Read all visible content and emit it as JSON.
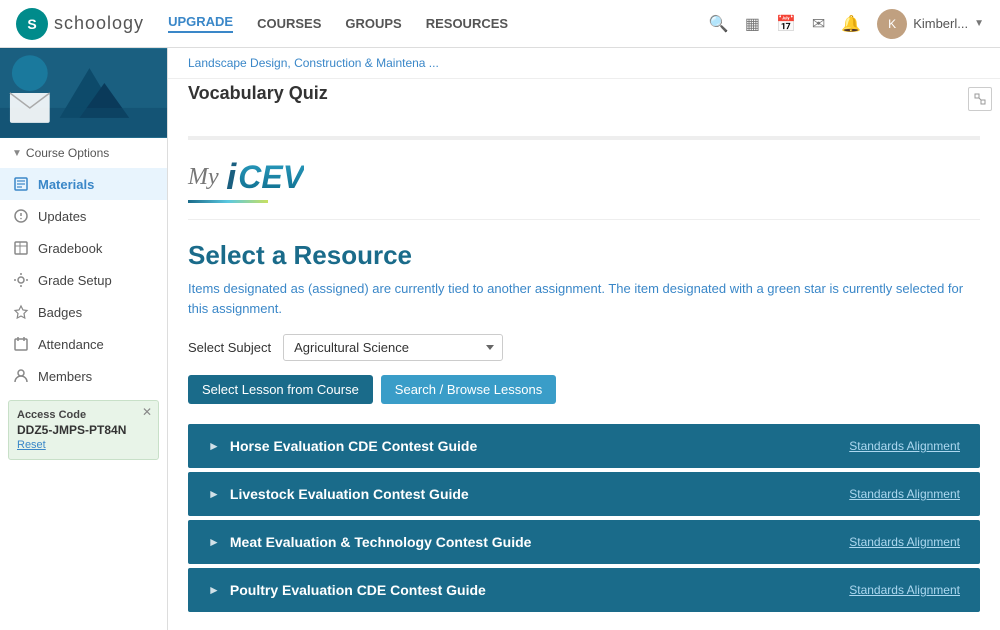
{
  "nav": {
    "logo_letter": "S",
    "logo_text": "schoology",
    "links": [
      {
        "label": "UPGRADE",
        "active": true
      },
      {
        "label": "COURSES"
      },
      {
        "label": "GROUPS"
      },
      {
        "label": "RESOURCES"
      }
    ],
    "username": "Kimberl...",
    "chevron": "▼"
  },
  "sidebar": {
    "course_options_label": "Course Options",
    "items": [
      {
        "label": "Materials",
        "icon": "📋",
        "active": true
      },
      {
        "label": "Updates",
        "icon": "📢",
        "active": false
      },
      {
        "label": "Gradebook",
        "icon": "📊",
        "active": false
      },
      {
        "label": "Grade Setup",
        "icon": "⚙",
        "active": false
      },
      {
        "label": "Badges",
        "icon": "🏅",
        "active": false
      },
      {
        "label": "Attendance",
        "icon": "📅",
        "active": false
      },
      {
        "label": "Members",
        "icon": "👤",
        "active": false
      }
    ],
    "access_code": {
      "label": "Access Code",
      "value": "DDZ5-JMPS-PT84N",
      "reset_label": "Reset"
    }
  },
  "breadcrumb": "Landscape Design, Construction & Maintena ...",
  "page_title": "Vocabulary Quiz",
  "icev": {
    "my_text": "My",
    "i_text": "i",
    "cev_text": "CEV"
  },
  "select_resource": {
    "title": "Select a Resource",
    "description": "Items designated as (assigned) are currently tied to another assignment. The item designated with a green star is currently selected for this assignment.",
    "subject_label": "Select Subject",
    "subject_value": "Agricultural Science",
    "btn_lesson": "Select Lesson from Course",
    "btn_browse": "Search / Browse Lessons"
  },
  "course_items": [
    {
      "title": "Horse Evaluation CDE Contest Guide",
      "standards_label": "Standards Alignment"
    },
    {
      "title": "Livestock Evaluation Contest Guide",
      "standards_label": "Standards Alignment"
    },
    {
      "title": "Meat Evaluation & Technology Contest Guide",
      "standards_label": "Standards Alignment"
    },
    {
      "title": "Poultry Evaluation CDE Contest Guide",
      "standards_label": "Standards Alignment"
    }
  ]
}
